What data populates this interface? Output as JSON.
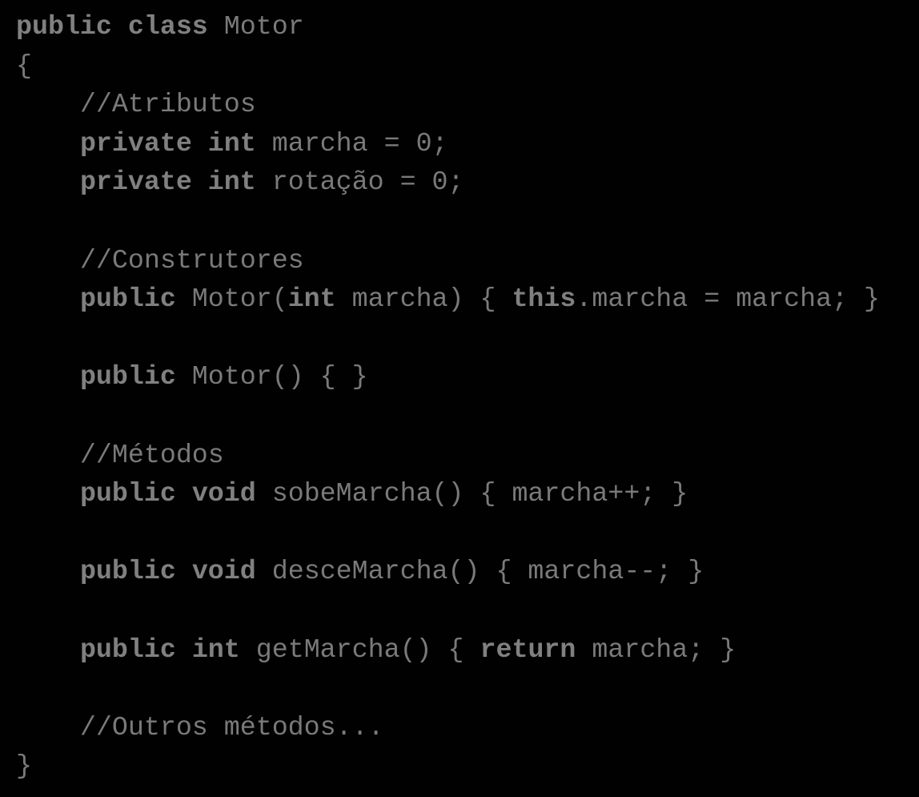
{
  "code": {
    "language": "java",
    "lines": [
      [
        {
          "t": "public",
          "k": 1
        },
        {
          "t": " "
        },
        {
          "t": "class",
          "k": 1
        },
        {
          "t": " Motor"
        }
      ],
      [
        {
          "t": "{"
        }
      ],
      [
        {
          "t": "    //Atributos"
        }
      ],
      [
        {
          "t": "    "
        },
        {
          "t": "private",
          "k": 1
        },
        {
          "t": " "
        },
        {
          "t": "int",
          "k": 1
        },
        {
          "t": " marcha = 0;"
        }
      ],
      [
        {
          "t": "    "
        },
        {
          "t": "private",
          "k": 1
        },
        {
          "t": " "
        },
        {
          "t": "int",
          "k": 1
        },
        {
          "t": " rotação = 0;"
        }
      ],
      [],
      [
        {
          "t": "    //Construtores"
        }
      ],
      [
        {
          "t": "    "
        },
        {
          "t": "public",
          "k": 1
        },
        {
          "t": " Motor("
        },
        {
          "t": "int",
          "k": 1
        },
        {
          "t": " marcha) { "
        },
        {
          "t": "this",
          "k": 1
        },
        {
          "t": ".marcha = marcha; }"
        }
      ],
      [],
      [
        {
          "t": "    "
        },
        {
          "t": "public",
          "k": 1
        },
        {
          "t": " Motor() { }"
        }
      ],
      [],
      [
        {
          "t": "    //Métodos"
        }
      ],
      [
        {
          "t": "    "
        },
        {
          "t": "public",
          "k": 1
        },
        {
          "t": " "
        },
        {
          "t": "void",
          "k": 1
        },
        {
          "t": " sobeMarcha() { marcha++; }"
        }
      ],
      [],
      [
        {
          "t": "    "
        },
        {
          "t": "public",
          "k": 1
        },
        {
          "t": " "
        },
        {
          "t": "void",
          "k": 1
        },
        {
          "t": " desceMarcha() { marcha--; }"
        }
      ],
      [],
      [
        {
          "t": "    "
        },
        {
          "t": "public",
          "k": 1
        },
        {
          "t": " "
        },
        {
          "t": "int",
          "k": 1
        },
        {
          "t": " getMarcha() { "
        },
        {
          "t": "return",
          "k": 1
        },
        {
          "t": " marcha; }"
        }
      ],
      [],
      [
        {
          "t": "    //Outros métodos..."
        }
      ],
      [
        {
          "t": "}"
        }
      ]
    ]
  },
  "colors": {
    "background": "#010101",
    "text": "#7a7a7a",
    "keyword": "#808080"
  }
}
